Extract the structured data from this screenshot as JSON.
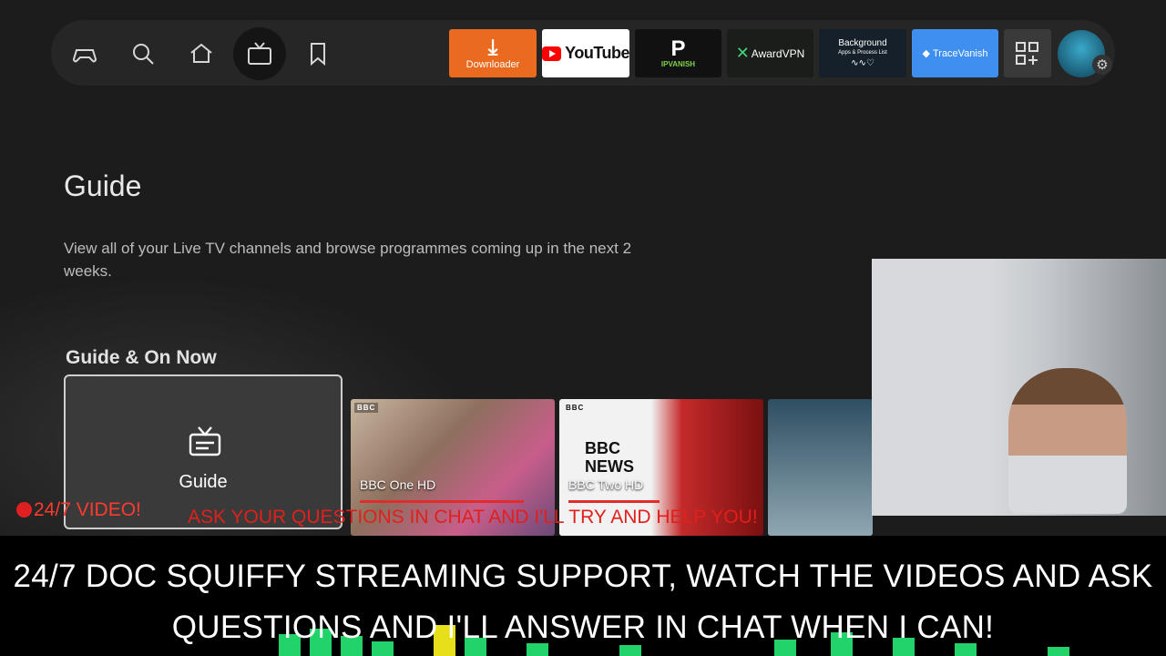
{
  "nav": {
    "icons": [
      "gamepad-icon",
      "search-icon",
      "home-icon",
      "live-tv-icon",
      "bookmark-icon"
    ],
    "active": "live-tv-icon",
    "apps": [
      {
        "name": "Downloader",
        "label": "Downloader"
      },
      {
        "name": "YouTube",
        "label": "YouTube"
      },
      {
        "name": "IPVanish",
        "label": "IPVANISH"
      },
      {
        "name": "AwardVPN",
        "label": "AwardVPN"
      },
      {
        "name": "Background Apps & Process List",
        "label": "Background",
        "sublabel": "Apps & Process List"
      },
      {
        "name": "TraceVanish",
        "label": "TraceVanish"
      }
    ],
    "colors": {
      "downloader": "#ea6b1f",
      "tracevanish": "#3f8ff0",
      "ipvanish": "#7fd24b"
    }
  },
  "page": {
    "title": "Guide",
    "description": "View all of your Live TV channels and browse programmes coming up in the next 2 weeks."
  },
  "section": {
    "title": "Guide & On Now",
    "guide_card_label": "Guide",
    "channels": [
      {
        "name": "BBC One HD",
        "progress": 0.8
      },
      {
        "name": "BBC Two HD",
        "progress": 0.55
      }
    ],
    "bbc_logo": "BBC",
    "bbc_news_text": "BBC NEWS"
  },
  "overlay": {
    "live_badge": "24/7 VIDEO!",
    "ask_banner": "ASK YOUR QUESTIONS IN CHAT AND I'LL TRY AND HELP YOU!",
    "ticker": "24/7 DOC SQUIFFY STREAMING SUPPORT, WATCH THE VIDEOS AND ASK QUESTIONS AND I'LL ANSWER IN CHAT WHEN I CAN!"
  }
}
